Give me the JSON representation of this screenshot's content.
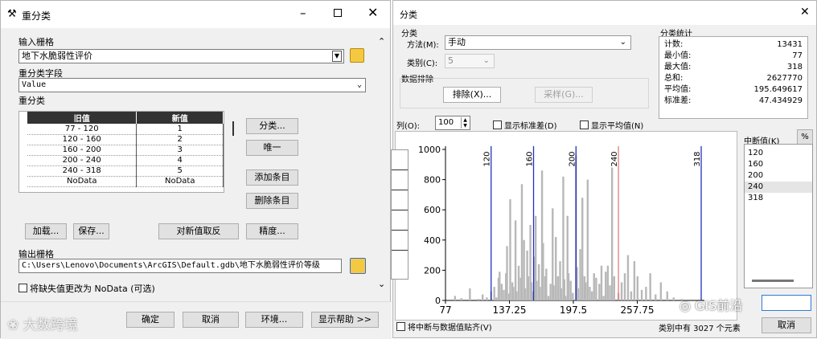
{
  "left": {
    "title": "重分类",
    "input_raster_label": "输入栅格",
    "input_raster_value": "地下水脆弱性评价",
    "field_label": "重分类字段",
    "field_value": "Value",
    "reclass_label": "重分类",
    "columns": [
      "旧值",
      "新值"
    ],
    "rows": [
      {
        "old": "77 - 120",
        "new": "1"
      },
      {
        "old": "120 - 160",
        "new": "2"
      },
      {
        "old": "160 - 200",
        "new": "3"
      },
      {
        "old": "200 - 240",
        "new": "4"
      },
      {
        "old": "240 - 318",
        "new": "5"
      },
      {
        "old": "NoData",
        "new": "NoData"
      }
    ],
    "side_buttons": {
      "classify": "分类...",
      "unique": "唯一",
      "add": "添加条目",
      "delete": "删除条目",
      "precision": "精度..."
    },
    "bottom_buttons": {
      "load": "加载...",
      "save": "保存...",
      "reverse": "对新值取反"
    },
    "output_label": "输出栅格",
    "output_value": "C:\\Users\\Lenovo\\Documents\\ArcGIS\\Default.gdb\\地下水脆弱性评价等级",
    "nodata_check": "将缺失值更改为 NoData (可选)",
    "footer": {
      "ok": "确定",
      "cancel": "取消",
      "env": "环境...",
      "help": "显示帮助 >>"
    },
    "watermark": "大数跨境"
  },
  "right": {
    "title": "分类",
    "group_classify": "分类",
    "method_label": "方法(M):",
    "method_value": "手动",
    "classes_label": "类别(C):",
    "classes_value": "5",
    "exclusion_label": "数据排除",
    "exclude_btn": "排除(X)...",
    "sample_btn": "采样(G)...",
    "stats_title": "分类统计",
    "stats": [
      {
        "k": "计数:",
        "v": "13431"
      },
      {
        "k": "最小值:",
        "v": "77"
      },
      {
        "k": "最大值:",
        "v": "318"
      },
      {
        "k": "总和:",
        "v": "2627770"
      },
      {
        "k": "平均值:",
        "v": "195.649617"
      },
      {
        "k": "标准差:",
        "v": "47.434929"
      }
    ],
    "columns_label": "列(O):",
    "columns_value": "100",
    "show_std": "显示标准差(D)",
    "show_mean": "显示平均值(N)",
    "break_label": "中断值(K)",
    "percent_btn": "%",
    "break_values": [
      "120",
      "160",
      "200",
      "240",
      "318"
    ],
    "snap_label": "将中断与数据值贴齐(V)",
    "elements_info": "类别中有 3027 个元素",
    "cancel": "取消",
    "watermark": "GIS前沿"
  },
  "chart_data": {
    "type": "bar",
    "yticks": [
      "0",
      "200",
      "400",
      "600",
      "800",
      "1000"
    ],
    "xticks": [
      "77",
      "137.25",
      "197.5",
      "257.75"
    ],
    "ylim": [
      0,
      1000
    ],
    "xlim": [
      77,
      318
    ],
    "breaks": [
      120,
      160,
      200,
      240,
      318
    ],
    "break_labels": [
      "120",
      "160",
      "200",
      "240",
      "318"
    ],
    "selected_break": 240,
    "bars": [
      [
        86,
        30
      ],
      [
        92,
        15
      ],
      [
        100,
        80
      ],
      [
        108,
        10
      ],
      [
        112,
        40
      ],
      [
        116,
        20
      ],
      [
        120,
        60
      ],
      [
        123,
        90
      ],
      [
        125,
        20
      ],
      [
        127,
        150
      ],
      [
        128,
        190
      ],
      [
        130,
        110
      ],
      [
        132,
        70
      ],
      [
        134,
        180
      ],
      [
        135,
        360
      ],
      [
        137,
        45
      ],
      [
        138,
        670
      ],
      [
        140,
        120
      ],
      [
        141,
        90
      ],
      [
        143,
        530
      ],
      [
        144,
        60
      ],
      [
        146,
        230
      ],
      [
        148,
        150
      ],
      [
        149,
        770
      ],
      [
        151,
        400
      ],
      [
        152,
        80
      ],
      [
        154,
        330
      ],
      [
        155,
        160
      ],
      [
        157,
        500
      ],
      [
        158,
        120
      ],
      [
        159,
        60
      ],
      [
        161,
        290
      ],
      [
        162,
        560
      ],
      [
        163,
        130
      ],
      [
        165,
        240
      ],
      [
        166,
        90
      ],
      [
        168,
        860
      ],
      [
        169,
        380
      ],
      [
        171,
        160
      ],
      [
        172,
        210
      ],
      [
        174,
        30
      ],
      [
        176,
        110
      ],
      [
        178,
        610
      ],
      [
        179,
        100
      ],
      [
        181,
        420
      ],
      [
        183,
        160
      ],
      [
        185,
        260
      ],
      [
        186,
        80
      ],
      [
        188,
        820
      ],
      [
        189,
        140
      ],
      [
        190,
        30
      ],
      [
        192,
        560
      ],
      [
        193,
        180
      ],
      [
        195,
        130
      ],
      [
        197,
        50
      ],
      [
        200,
        960
      ],
      [
        201,
        220
      ],
      [
        202,
        80
      ],
      [
        204,
        340
      ],
      [
        206,
        680
      ],
      [
        208,
        160
      ],
      [
        209,
        120
      ],
      [
        211,
        800
      ],
      [
        213,
        90
      ],
      [
        215,
        60
      ],
      [
        217,
        180
      ],
      [
        219,
        150
      ],
      [
        222,
        110
      ],
      [
        224,
        230
      ],
      [
        226,
        30
      ],
      [
        228,
        190
      ],
      [
        230,
        230
      ],
      [
        232,
        100
      ],
      [
        234,
        880
      ],
      [
        236,
        160
      ],
      [
        240,
        50
      ],
      [
        243,
        120
      ],
      [
        246,
        180
      ],
      [
        249,
        300
      ],
      [
        252,
        60
      ],
      [
        255,
        260
      ],
      [
        258,
        160
      ],
      [
        262,
        70
      ],
      [
        266,
        90
      ],
      [
        270,
        180
      ],
      [
        275,
        40
      ],
      [
        280,
        120
      ],
      [
        286,
        60
      ],
      [
        292,
        20
      ],
      [
        300,
        10
      ]
    ]
  }
}
